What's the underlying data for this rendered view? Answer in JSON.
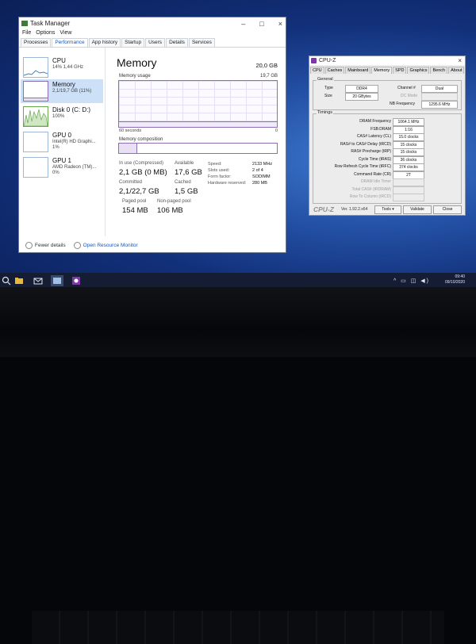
{
  "task_manager": {
    "title": "Task Manager",
    "window_controls": [
      "–",
      "□",
      "×"
    ],
    "menu": [
      "File",
      "Options",
      "View"
    ],
    "tabs": [
      "Processes",
      "Performance",
      "App history",
      "Startup",
      "Users",
      "Details",
      "Services"
    ],
    "active_tab": "Performance",
    "sidebar": [
      {
        "name": "CPU",
        "sub": "14% 1,44 GHz"
      },
      {
        "name": "Memory",
        "sub": "2,1/19,7 GB (11%)"
      },
      {
        "name": "Disk 0 (C: D:)",
        "sub": "100%"
      },
      {
        "name": "GPU 0",
        "sub": "Intel(R) HD Graphi...",
        "sub2": "1%"
      },
      {
        "name": "GPU 1",
        "sub": "AMD Radeon (TM)...",
        "sub2": "0%"
      }
    ],
    "memory": {
      "title": "Memory",
      "total": "20,0 GB",
      "usage_label": "Memory usage",
      "usage_max": "19,7 GB",
      "usage_fraction": 0.11,
      "time_left": "60 seconds",
      "time_right": "0",
      "composition_label": "Memory composition",
      "in_use_label": "In use (Compressed)",
      "in_use_value": "2,1 GB (0 MB)",
      "available_label": "Available",
      "available_value": "17,6 GB",
      "committed_label": "Committed",
      "committed_value": "2,1/22,7 GB",
      "cached_label": "Cached",
      "cached_value": "1,5 GB",
      "paged_label": "Paged pool",
      "paged_value": "154 MB",
      "nonpaged_label": "Non-paged pool",
      "nonpaged_value": "106 MB",
      "speed_label": "Speed:",
      "speed_value": "2133 MHz",
      "slots_label": "Slots used:",
      "slots_value": "2 of 4",
      "form_label": "Form factor:",
      "form_value": "SODIMM",
      "hw_label": "Hardware reserved:",
      "hw_value": "280 MB"
    },
    "footer": {
      "fewer_details": "Fewer details",
      "open_monitor": "Open Resource Monitor"
    }
  },
  "cpuz": {
    "title": "CPU-Z",
    "tabs": [
      "CPU",
      "Caches",
      "Mainboard",
      "Memory",
      "SPD",
      "Graphics",
      "Bench",
      "About"
    ],
    "active_tab": "Memory",
    "general_title": "General",
    "type_label": "Type",
    "type_value": "DDR4",
    "size_label": "Size",
    "size_value": "20 GBytes",
    "channel_label": "Channel #",
    "channel_value": "Dual",
    "dc_label": "DC Mode",
    "nb_label": "NB Frequency",
    "nb_value": "1295.6 MHz",
    "timings_title": "Timings",
    "timings": [
      {
        "label": "DRAM Frequency",
        "value": "1064.1 MHz",
        "dim": false
      },
      {
        "label": "FSB:DRAM",
        "value": "1:16",
        "dim": false
      },
      {
        "label": "CAS# Latency (CL)",
        "value": "15.0 clocks",
        "dim": false
      },
      {
        "label": "RAS# to CAS# Delay (tRCD)",
        "value": "15 clocks",
        "dim": false
      },
      {
        "label": "RAS# Precharge (tRP)",
        "value": "15 clocks",
        "dim": false
      },
      {
        "label": "Cycle Time (tRAS)",
        "value": "36 clocks",
        "dim": false
      },
      {
        "label": "Row Refresh Cycle Time (tRFC)",
        "value": "374 clocks",
        "dim": false
      },
      {
        "label": "Command Rate (CR)",
        "value": "2T",
        "dim": false
      },
      {
        "label": "DRAM Idle Timer",
        "value": "",
        "dim": true
      },
      {
        "label": "Total CAS# (tRDRAM)",
        "value": "",
        "dim": true
      },
      {
        "label": "Row To Column (tRCD)",
        "value": "",
        "dim": true
      }
    ],
    "footer": {
      "logo": "CPU-Z",
      "version": "Ver. 1.92.2.x64",
      "tools": "Tools",
      "validate": "Validate",
      "close": "Close"
    }
  },
  "taskbar": {
    "tray_icons": "^ ▭ ◫ ◀)",
    "time": "09:40",
    "date": "09/10/2020"
  }
}
